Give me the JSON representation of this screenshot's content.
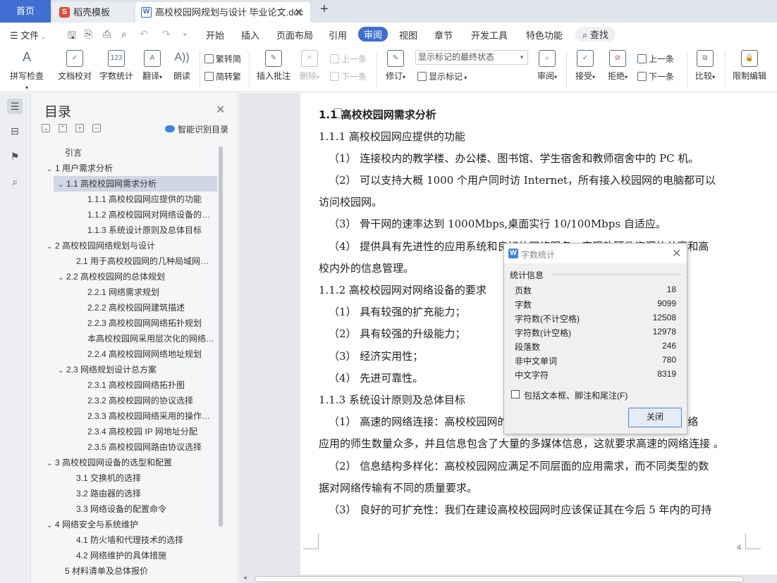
{
  "tabs": {
    "home": "首页",
    "template": "稻壳模板",
    "document": "高校校园网规划与设计 毕业论文.doc",
    "close": "✕",
    "new_tab": "+"
  },
  "menu": {
    "file": "文件",
    "items": [
      "开始",
      "插入",
      "页面布局",
      "引用",
      "审阅",
      "视图",
      "章节",
      "开发工具",
      "特色功能"
    ],
    "active": "审阅",
    "search": "查找"
  },
  "ribbon": {
    "spellcheck": "拼写检查",
    "doc_proof": "文档校对",
    "word_count": "字数统计",
    "translate": "翻译",
    "read_aloud": "朗读",
    "trad_simp": "繁转简",
    "simp_trad": "简转繁",
    "insert_comment": "插入批注",
    "delete": "删除",
    "prev_comment": "上一条",
    "next_comment": "下一条",
    "track_changes": "修订",
    "markup_mode": "显示标记的最终状态",
    "show_markup": "显示标记",
    "review": "审阅",
    "accept": "接受",
    "reject": "拒绝",
    "prev": "上一条",
    "next": "下一条",
    "compare": "比较",
    "restrict_edit": "限制编辑",
    "word_count_icon_text": "123"
  },
  "toc": {
    "title": "目录",
    "smart": "智能识别目录",
    "items": [
      {
        "caret": "",
        "text": "引言"
      },
      {
        "caret": "⌄",
        "text": "1  用户需求分析"
      },
      {
        "caret": "⌄",
        "text": "1.1  高校校园网需求分析"
      },
      {
        "caret": "",
        "text": "1.1.1  高校校园网应提供的功能"
      },
      {
        "caret": "",
        "text": "1.1.2  高校校园网对网络设备的要求"
      },
      {
        "caret": "",
        "text": "1.1.3  系统设计原则及总体目标"
      },
      {
        "caret": "⌄",
        "text": "2  高校校园网络规划与设计"
      },
      {
        "caret": "",
        "text": "2.1  用于高校校园网的几种局域网技术"
      },
      {
        "caret": "⌄",
        "text": "2.2  高校校园网的总体规划"
      },
      {
        "caret": "",
        "text": "2.2.1  网络需求规划"
      },
      {
        "caret": "",
        "text": "2.2.2  高校校园网建筑描述"
      },
      {
        "caret": "",
        "text": "2.2.3  高校校园网网络拓扑规划"
      },
      {
        "caret": "",
        "text": "本高校校园网采用层次化的网络拓扑结构"
      },
      {
        "caret": "",
        "text": "2.2.4  高校校园网网络地址规划"
      },
      {
        "caret": "⌄",
        "text": "2.3  网络规划设计总方案"
      },
      {
        "caret": "",
        "text": "2.3.1  高校校园网络拓扑图"
      },
      {
        "caret": "",
        "text": "2.3.2  高校校园网的协议选择"
      },
      {
        "caret": "",
        "text": "2.3.3 高校校园网络采用的操作系统"
      },
      {
        "caret": "",
        "text": "2.3.4  高校校园 IP 网地址分配"
      },
      {
        "caret": "",
        "text": "2.3.5  高校校园网路由协议选择"
      },
      {
        "caret": "⌄",
        "text": "3  高校校园网设备的选型和配置"
      },
      {
        "caret": "",
        "text": "3.1  交换机的选择"
      },
      {
        "caret": "",
        "text": "3.2  路由器的选择"
      },
      {
        "caret": "",
        "text": "3.3  网络设备的配置命令"
      },
      {
        "caret": "⌄",
        "text": "4  网络安全与系统维护"
      },
      {
        "caret": "",
        "text": "4.1  防火墙和代理技术的选择"
      },
      {
        "caret": "",
        "text": "4.2  网络维护的具体措施"
      },
      {
        "caret": "",
        "text": "5  材料清单及总体报价"
      }
    ]
  },
  "document": {
    "lines": [
      "1.1  高校校园网需求分析",
      "1.1.1 高校校园网应提供的功能",
      "（1）  连接校内的教学楼、办公楼、图书馆、学生宿舍和教师宿舍中的 PC 机。",
      "（2）  可以支持大概 1000 个用户同时访 Internet，所有接入校园网的电脑都可以",
      "访问校园网。",
      "（3）  骨干网的速率达到 1000Mbps,桌面实行 10/100Mbps 自适应。",
      "（4）  提供具有先进性的应用系统和良好的网络服务，实现软硬件资源的共享和高",
      "校内外的信息管理。",
      "1.1.2 高校校园网对网络设备的要求",
      "（1）  具有较强的扩充能力；",
      "（2）  具有较强的升级能力；",
      "（3）  经济实用性；",
      "（4）  先进可靠性。",
      "1.1.3 系统设计原则及总体目标",
      "（1）  高速的网络连接：高校校园网的用户数量多，信息传输量很大，参与网络",
      "应用的师生数量众多，并且信息包含了大量的多媒体信息，这就要求高速的网络连接 。",
      "（2）  信息结构多样化：高校校园网应满足不同层面的应用需求，而不同类型的数",
      "据对网络传输有不同的质量要求。",
      "（3）  良好的可扩充性：我们在建设高校校园网时应该保证其在今后 5 年内的可持"
    ],
    "page_number": "4"
  },
  "dialog": {
    "title": "字数统计",
    "group": "统计信息",
    "stats": [
      {
        "label": "页数",
        "value": "18"
      },
      {
        "label": "字数",
        "value": "9099"
      },
      {
        "label": "字符数(不计空格)",
        "value": "12508"
      },
      {
        "label": "字符数(计空格)",
        "value": "12978"
      },
      {
        "label": "段落数",
        "value": "246"
      },
      {
        "label": "非中文单词",
        "value": "780"
      },
      {
        "label": "中文字符",
        "value": "8319"
      }
    ],
    "include_label": "包括文本框、脚注和尾注(F)",
    "close_button": "关闭"
  }
}
